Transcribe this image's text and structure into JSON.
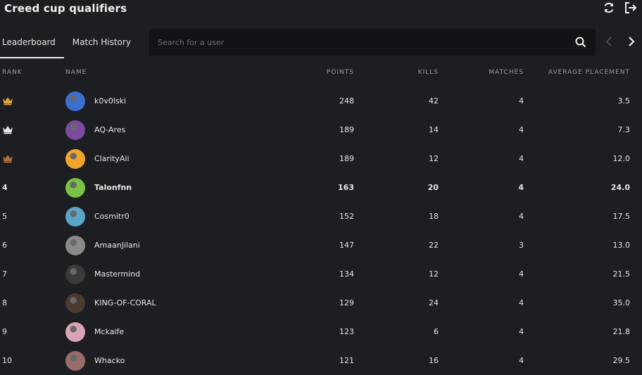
{
  "header": {
    "title": "Creed cup qualifiers"
  },
  "tabs": [
    {
      "label": "Leaderboard",
      "active": true
    },
    {
      "label": "Match History",
      "active": false
    }
  ],
  "search": {
    "placeholder": "Search for a user",
    "value": ""
  },
  "columns": {
    "rank": "RANK",
    "name": "NAME",
    "points": "POINTS",
    "kills": "KILLS",
    "matches": "MATCHES",
    "avg": "AVERAGE PLACEMENT"
  },
  "colors": {
    "background": "#1d1e22",
    "search_bg": "#121316",
    "gold": "#d9a441",
    "silver": "#e8e8e8",
    "bronze": "#b0703a"
  },
  "rows": [
    {
      "rank": "",
      "medal": "gold",
      "name": "k0v0lski",
      "points": "248",
      "kills": "42",
      "matches": "4",
      "avg": "3.5",
      "avatar_color": "#3b6fd1"
    },
    {
      "rank": "",
      "medal": "silver",
      "name": "AQ-Ares",
      "points": "189",
      "kills": "14",
      "matches": "4",
      "avg": "7.3",
      "avatar_color": "#7a4a9c"
    },
    {
      "rank": "",
      "medal": "bronze",
      "name": "ClarityAli",
      "points": "189",
      "kills": "12",
      "matches": "4",
      "avg": "12.0",
      "avatar_color": "#f0a52a"
    },
    {
      "rank": "4",
      "medal": "",
      "name": "Talonfnn",
      "points": "163",
      "kills": "20",
      "matches": "4",
      "avg": "24.0",
      "avatar_color": "#7bc143",
      "bold": true
    },
    {
      "rank": "5",
      "medal": "",
      "name": "Cosmitr0",
      "points": "152",
      "kills": "18",
      "matches": "4",
      "avg": "17.5",
      "avatar_color": "#5aa4c8"
    },
    {
      "rank": "6",
      "medal": "",
      "name": "AmaanJilani",
      "points": "147",
      "kills": "22",
      "matches": "3",
      "avg": "13.0",
      "avatar_color": "#8a8a8a"
    },
    {
      "rank": "7",
      "medal": "",
      "name": "Mastermind",
      "points": "134",
      "kills": "12",
      "matches": "4",
      "avg": "21.5",
      "avatar_color": "#3a3a3a"
    },
    {
      "rank": "8",
      "medal": "",
      "name": "KING-OF-CORAL",
      "points": "129",
      "kills": "24",
      "matches": "4",
      "avg": "35.0",
      "avatar_color": "#4a3b30"
    },
    {
      "rank": "9",
      "medal": "",
      "name": "Mckaife",
      "points": "123",
      "kills": "6",
      "matches": "4",
      "avg": "21.8",
      "avatar_color": "#d9a3b8"
    },
    {
      "rank": "10",
      "medal": "",
      "name": "Whacko",
      "points": "121",
      "kills": "16",
      "matches": "4",
      "avg": "29.5",
      "avatar_color": "#9a6b6b"
    }
  ]
}
